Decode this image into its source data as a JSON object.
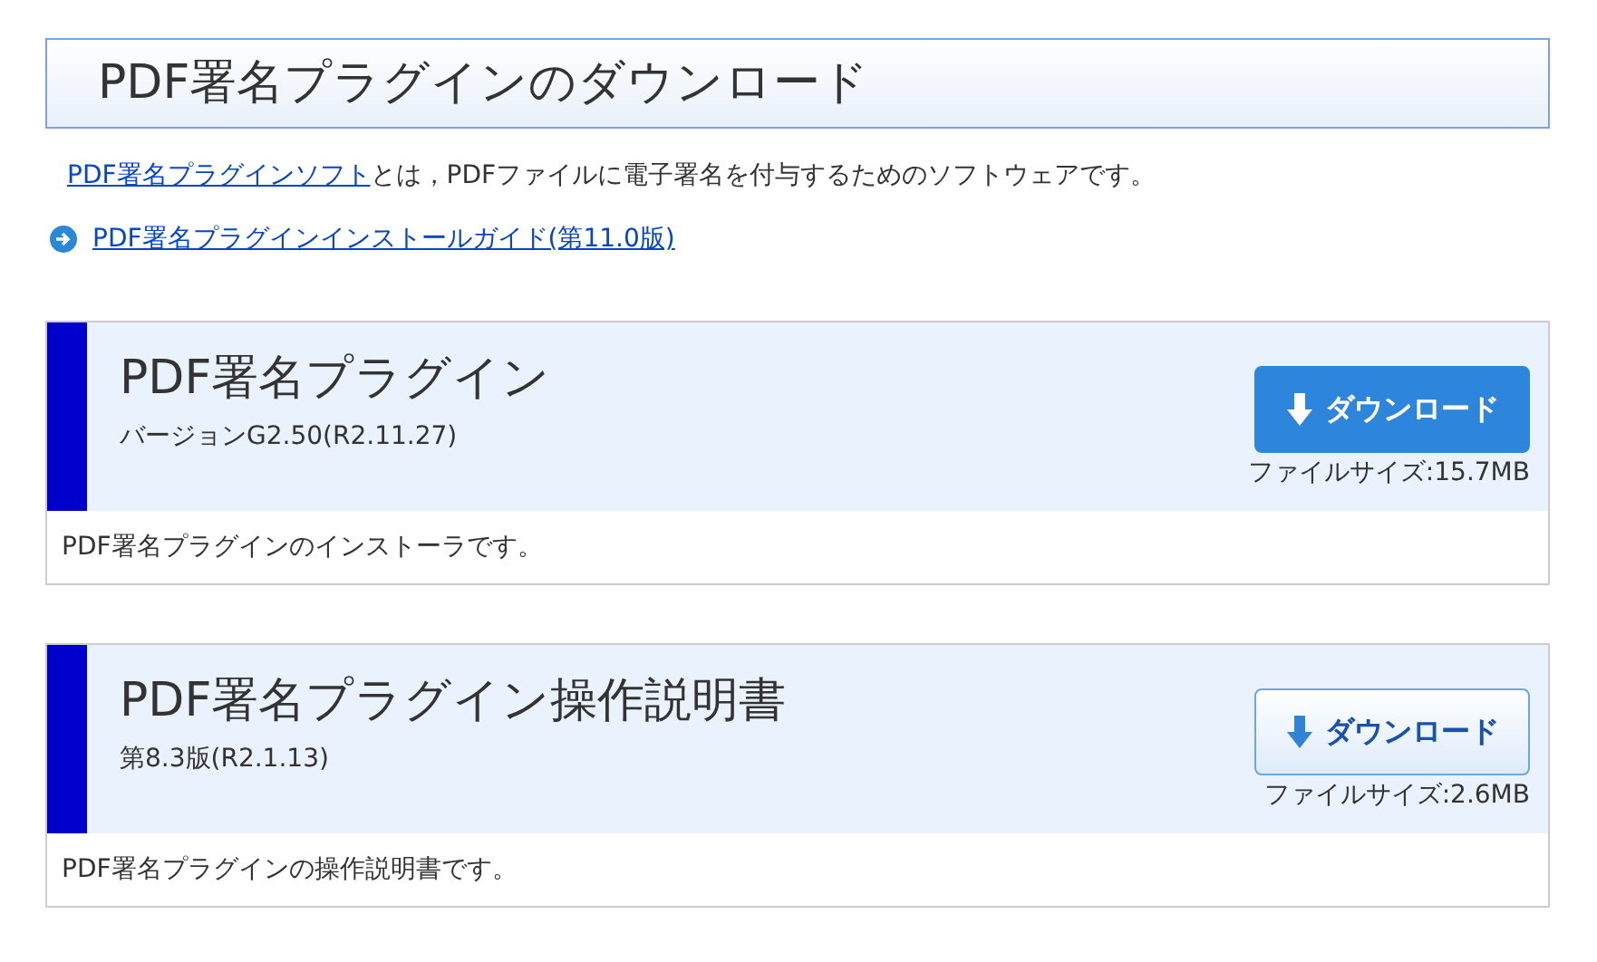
{
  "title": "PDF署名プラグインのダウンロード",
  "intro": {
    "link": "PDF署名プラグインソフト",
    "text": "とは，PDFファイルに電子署名を付与するためのソフトウェアです。"
  },
  "guide_link": "PDF署名プラグインインストールガイド(第11.0版)",
  "downloads": [
    {
      "name": "PDF署名プラグイン",
      "version": "バージョンG2.50(R2.11.27)",
      "button": "ダウンロード",
      "highlighted": true,
      "size": "ファイルサイズ:15.7MB",
      "description": "PDF署名プラグインのインストーラです。"
    },
    {
      "name": "PDF署名プラグイン操作説明書",
      "version": "第8.3版(R2.1.13)",
      "button": "ダウンロード",
      "highlighted": false,
      "size": "ファイルサイズ:2.6MB",
      "description": "PDF署名プラグインの操作説明書です。"
    }
  ]
}
